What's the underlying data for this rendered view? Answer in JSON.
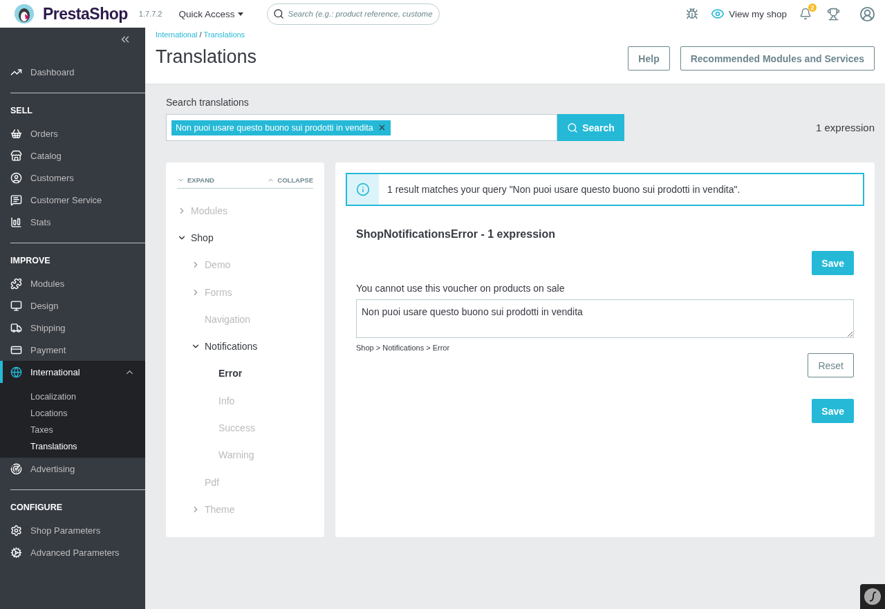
{
  "header": {
    "brand": "PrestaShop",
    "version": "1.7.7.2",
    "quick_access": "Quick Access",
    "search": {
      "placeholder": "Search (e.g.: product reference, custome"
    },
    "view_shop": "View my shop",
    "notifications_count": "2"
  },
  "sidebar": {
    "top": [
      {
        "label": "Dashboard",
        "selected": false
      }
    ],
    "sections": [
      {
        "title": "SELL",
        "items": [
          {
            "label": "Orders",
            "selected": false
          },
          {
            "label": "Catalog",
            "selected": false
          },
          {
            "label": "Customers",
            "selected": false
          },
          {
            "label": "Customer Service",
            "selected": false
          },
          {
            "label": "Stats",
            "selected": false
          }
        ]
      },
      {
        "title": "IMPROVE",
        "items": [
          {
            "label": "Modules",
            "selected": false
          },
          {
            "label": "Design",
            "selected": false
          },
          {
            "label": "Shipping",
            "selected": false
          },
          {
            "label": "Payment",
            "selected": false
          },
          {
            "label": "International",
            "selected": true,
            "expanded": true,
            "children": [
              {
                "label": "Localization",
                "selected": false
              },
              {
                "label": "Locations",
                "selected": false
              },
              {
                "label": "Taxes",
                "selected": false
              },
              {
                "label": "Translations",
                "selected": true
              }
            ]
          },
          {
            "label": "Advertising",
            "selected": false
          }
        ]
      },
      {
        "title": "CONFIGURE",
        "items": [
          {
            "label": "Shop Parameters",
            "selected": false
          },
          {
            "label": "Advanced Parameters",
            "selected": false
          }
        ]
      }
    ]
  },
  "breadcrumb": [
    "International",
    "Translations"
  ],
  "breadcrumb_separator": "/",
  "page_title": "Translations",
  "toolbar_buttons": [
    "Help",
    "Recommended Modules and Services"
  ],
  "search": {
    "label": "Search translations",
    "tags": [
      "Non puoi usare questo buono sui prodotti in vendita"
    ],
    "button": "Search",
    "count": "1 expression"
  },
  "tree": {
    "expand": "EXPAND",
    "collapse": "COLLAPSE",
    "items": [
      {
        "label": "Modules",
        "kind": "folder",
        "expanded": false,
        "selected": false
      },
      {
        "label": "Shop",
        "kind": "folder",
        "expanded": true,
        "selected": false,
        "children": [
          {
            "label": "Demo",
            "kind": "folder",
            "expanded": false,
            "selected": false
          },
          {
            "label": "Forms",
            "kind": "folder",
            "expanded": false,
            "selected": false
          },
          {
            "label": "Navigation",
            "kind": "leaf",
            "expanded": false,
            "selected": false
          },
          {
            "label": "Notifications",
            "kind": "folder",
            "expanded": true,
            "selected": false,
            "children": [
              {
                "label": "Error",
                "kind": "leaf",
                "expanded": false,
                "selected": true
              },
              {
                "label": "Info",
                "kind": "leaf",
                "expanded": false,
                "selected": false
              },
              {
                "label": "Success",
                "kind": "leaf",
                "expanded": false,
                "selected": false
              },
              {
                "label": "Warning",
                "kind": "leaf",
                "expanded": false,
                "selected": false
              }
            ]
          },
          {
            "label": "Pdf",
            "kind": "leaf",
            "expanded": false,
            "selected": false
          },
          {
            "label": "Theme",
            "kind": "folder",
            "expanded": false,
            "selected": false
          }
        ]
      }
    ]
  },
  "results": {
    "alert": "1 result matches your query \"Non puoi usare questo buono sui prodotti in vendita\".",
    "domain_title": "ShopNotificationsError - 1 expression",
    "save": "Save",
    "expressions": [
      {
        "source": "You cannot use this voucher on products on sale",
        "value": "Non puoi usare questo buono sui prodotti in vendita",
        "path": "Shop > Notifications > Error",
        "reset": "Reset"
      }
    ],
    "save_bottom": "Save"
  }
}
